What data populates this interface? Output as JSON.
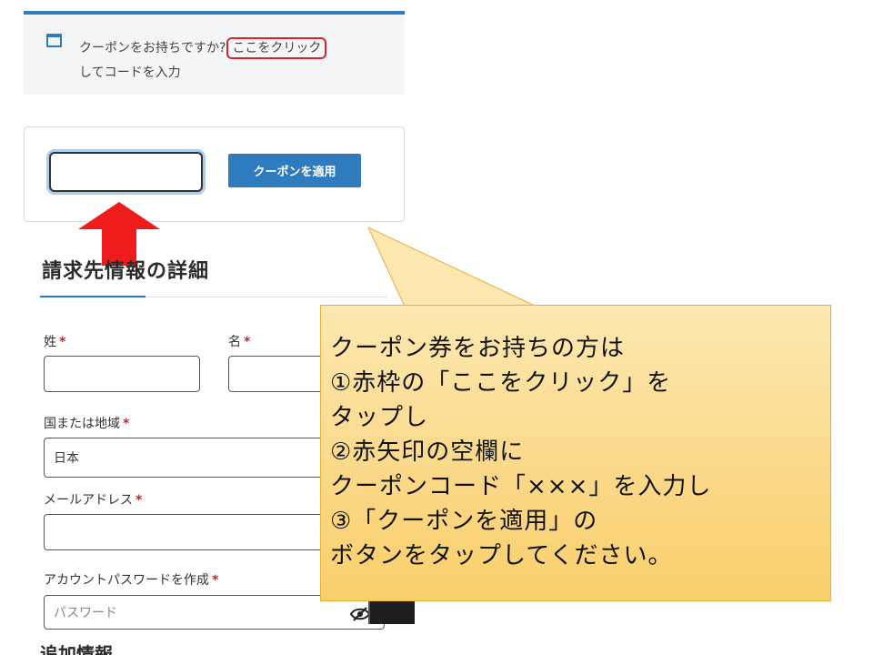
{
  "notice": {
    "text": "クーポンをお持ちですか?",
    "link": "ここをクリック",
    "text_after": "してコードを入力",
    "icon": "window-icon",
    "accent_color": "#2e7cbf",
    "highlight_color": "#d8232a"
  },
  "coupon": {
    "input_value": "",
    "button_label": "クーポンを適用"
  },
  "arrow": {
    "icon": "red-arrow-up-icon",
    "color": "#ee1c1c"
  },
  "billing": {
    "title": "請求先情報の詳細",
    "last_name_label": "姓",
    "first_name_label": "名",
    "country_label": "国または地域",
    "country_value": "日本",
    "email_label": "メールアドレス",
    "password_label": "アカウントパスワードを作成",
    "password_placeholder": "パスワード",
    "required_mark": "*",
    "next_section_title": "追加情報"
  },
  "callout": {
    "lines": [
      "クーポン券をお持ちの方は",
      "①赤枠の「ここをクリック」を",
      "タップし",
      "②赤矢印の空欄に",
      "クーポンコード「×××」を入力し",
      "③「クーポンを適用」の",
      "ボタンをタップしてください。"
    ]
  }
}
